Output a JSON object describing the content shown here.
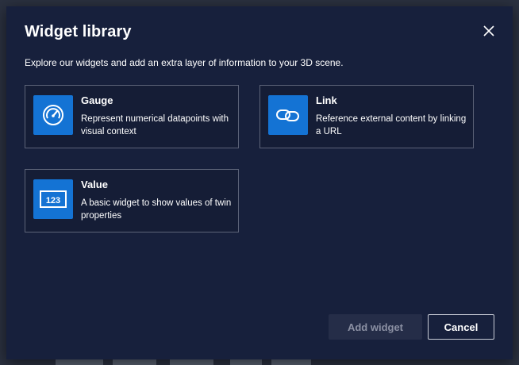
{
  "dialog": {
    "title": "Widget library",
    "subtitle": "Explore our widgets and add an extra layer of information to your 3D scene.",
    "close_icon": "close-icon"
  },
  "widgets": [
    {
      "title": "Gauge",
      "description": "Represent numerical datapoints with visual context",
      "icon": "gauge-icon"
    },
    {
      "title": "Link",
      "description": "Reference external content by linking a URL",
      "icon": "link-icon"
    },
    {
      "title": "Value",
      "description": "A basic widget to show values of twin properties",
      "icon": "value-123-icon",
      "icon_text": "123"
    }
  ],
  "footer": {
    "add_label": "Add widget",
    "cancel_label": "Cancel"
  },
  "colors": {
    "dialog_bg": "#17203c",
    "accent": "#1473d4",
    "card_border": "#5c6378"
  }
}
